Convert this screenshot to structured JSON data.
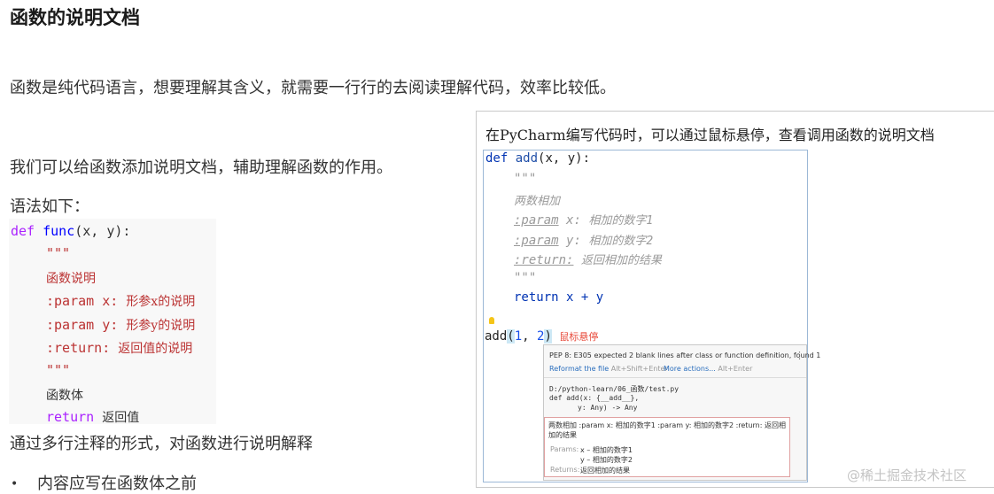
{
  "heading": "函数的说明文档",
  "para1": "函数是纯代码语言，想要理解其含义，就需要一行行的去阅读理解代码，效率比较低。",
  "para2": "我们可以给函数添加说明文档，辅助理解函数的作用。",
  "para3": "语法如下：",
  "code": {
    "def_kw": "def",
    "func_name": "func",
    "sig_rest": "(x, y):",
    "quote_open": "\"\"\"",
    "desc": "函数说明",
    "param_x_tag": ":param x:",
    "param_x_desc": "形参x的说明",
    "param_y_tag": ":param y:",
    "param_y_desc": "形参y的说明",
    "return_tag": ":return:",
    "return_desc": "返回值的说明",
    "quote_close": "\"\"\"",
    "body": "函数体",
    "return_kw": "return",
    "return_val": "返回值"
  },
  "para4": "通过多行注释的形式，对函数进行说明解释",
  "bullet1": "内容应写在函数体之前",
  "panel": {
    "caption": "在PyCharm编写代码时，可以通过鼠标悬停，查看调用函数的说明文档",
    "editor": {
      "def_kw": "def",
      "func_name": "add",
      "sig_rest": "(x, y):",
      "q1": "\"\"\"",
      "desc": "两数相加",
      "px_tag": ":param",
      "px_name": "x:",
      "px_desc": "相加的数字1",
      "py_tag": ":param",
      "py_name": "y:",
      "py_desc": "相加的数字2",
      "ret_tag": ":return:",
      "ret_desc": "返回相加的结果",
      "q2": "\"\"\"",
      "return_stmt": "return x + y",
      "call_name": "add",
      "call_open": "(",
      "call_arg1": "1",
      "call_sep": ", ",
      "call_arg2": "2",
      "call_close": ")",
      "hover_note": "鼠标悬停"
    },
    "popup": {
      "warning": "PEP 8: E305 expected 2 blank lines after class or function definition, found 1",
      "reformat": "Reformat the file",
      "reformat_key": "Alt+Shift+Enter",
      "more_actions": "More actions...",
      "more_key": "Alt+Enter",
      "path": "D:/python-learn/06_函数/test.py",
      "sig1": "def add(x: {__add__},",
      "sig2": "y: Any) -> Any",
      "doc_summary": "两数相加 :param x: 相加的数字1 :param y: 相加的数字2 :return: 返回相加的结果",
      "params_label": "Params:",
      "param_x": "x – 相加的数字1",
      "param_y": "y – 相加的数字2",
      "returns_label": "Returns:",
      "returns_val": "返回相加的结果",
      "menu_dots": "⋮"
    }
  },
  "watermark": "@稀土掘金技术社区",
  "colors": {
    "code_keyword": "#aa22ff",
    "code_funcname": "#0000ff",
    "code_doc": "#bb3333",
    "pycharm_keyword": "#0033b3",
    "hover_note": "#e84c3d",
    "popup_link": "#2a6ebd"
  }
}
